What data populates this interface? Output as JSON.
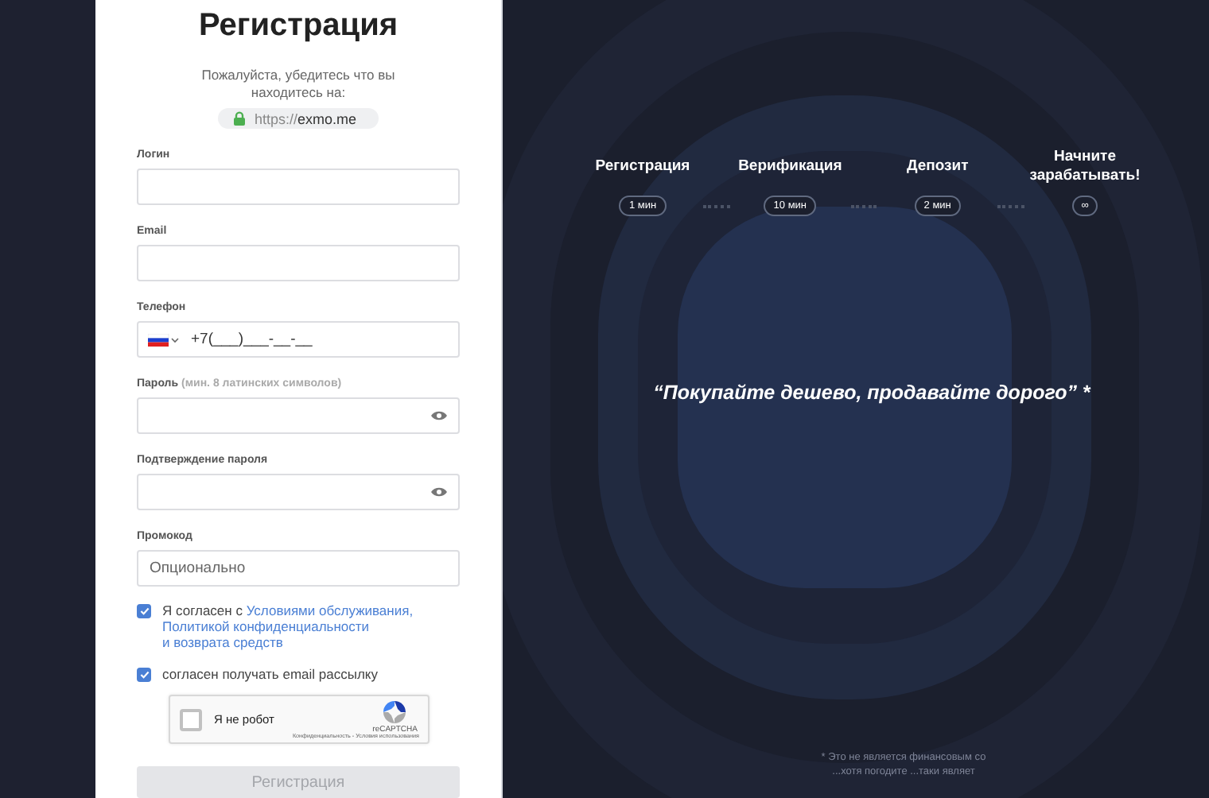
{
  "form": {
    "title": "Регистрация",
    "notice": "Пожалуйста, убедитесь что вы находитесь на:",
    "url": {
      "scheme": "https://",
      "host": "exmo.me",
      "secure": true
    },
    "fields": [
      {
        "kind": "text",
        "label": "Логин"
      },
      {
        "kind": "text",
        "label": "Email"
      },
      {
        "kind": "phone",
        "label": "Телефон",
        "value": "+7(___)___-__-__"
      },
      {
        "kind": "password",
        "label": "Пароль",
        "hint": "(мин. 8 латинских символов)"
      },
      {
        "kind": "password",
        "label": "Подтверждение пароля"
      },
      {
        "kind": "text",
        "label": "Промокод",
        "placeholder": "Опционально"
      }
    ],
    "agreements": [
      {
        "checked": true,
        "text": "Я согласен с ",
        "links": [
          "Условиями обслуживания,",
          "Политикой конфиденциальности",
          "и возврата средств"
        ]
      },
      {
        "checked": true,
        "text": "согласен получать email рассылку"
      }
    ],
    "captcha": {
      "checked": false,
      "label": "Я не робот",
      "brand": "reCAPTCHA",
      "terms": "Конфиденциальность - Условия использования"
    },
    "submit": {
      "label": "Регистрация",
      "disabled": true
    }
  },
  "promo": {
    "steps": [
      {
        "title": "Регистрация",
        "time": "1 мин"
      },
      {
        "title": "Верификация",
        "time": "10 мин"
      },
      {
        "title": "Депозит",
        "time": "2 мин"
      },
      {
        "title": "Начните зарабатывать!",
        "time": "∞"
      }
    ],
    "slogan": "“Покупайте дешево, продавайте дорого” *",
    "footnote": [
      "* Это не является финансовым со",
      "...хотя погодите ...таки являет"
    ]
  }
}
